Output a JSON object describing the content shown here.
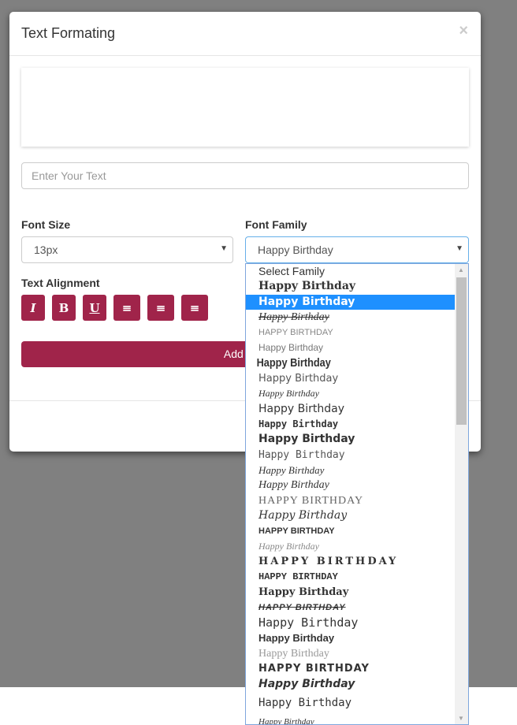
{
  "modal": {
    "title": "Text Formating",
    "close": "×",
    "text_placeholder": "Enter Your Text",
    "font_size_label": "Font Size",
    "font_size_value": "13px",
    "font_family_label": "Font Family",
    "font_family_value": "Happy Birthday",
    "alignment_label": "Text Alignment",
    "add_button": "Add Text",
    "accent": "#a0244a"
  },
  "format_buttons": [
    {
      "name": "italic",
      "glyph": "I"
    },
    {
      "name": "bold",
      "glyph": "B"
    },
    {
      "name": "underline",
      "glyph": "U"
    },
    {
      "name": "align-left",
      "glyph": "≡"
    },
    {
      "name": "align-center",
      "glyph": "≡"
    },
    {
      "name": "align-right",
      "glyph": "≡"
    }
  ],
  "dropdown": {
    "selected_index": 2,
    "items": [
      "Select Family",
      "Happy Birthday",
      "Happy Birthday",
      "Happy Birthday",
      "HAPPY BIRTHDAY",
      "Happy Birthday",
      "Happy Birthday",
      "Happy Birthday",
      "Happy Birthday",
      "Happy Birthday",
      "Happy Birthday",
      "Happy Birthday",
      "Happy Birthday",
      "Happy Birthday",
      "Happy Birthday",
      "HAPPY BIRTHDAY",
      "Happy Birthday",
      "HAPPY BIRTHDAY",
      "Happy Birthday",
      "HAPPY BIRTHDAY",
      "HAPPY BIRTHDAY",
      "Happy Birthday",
      "HAPPY BIRTHDAY",
      "Happy Birthday",
      "Happy Birthday",
      "Happy Birthday",
      "HAPPY BIRTHDAY",
      "Happy Birthday",
      "Happy Birthday",
      "Happy Birthday"
    ]
  }
}
